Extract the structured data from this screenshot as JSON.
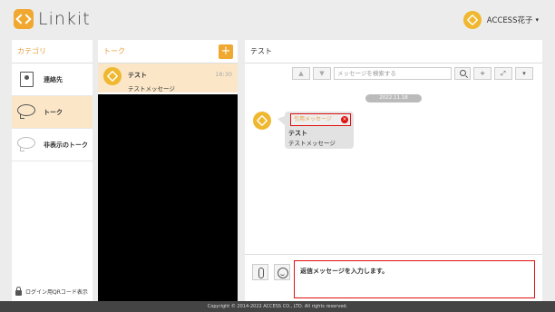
{
  "app": {
    "logo_text": "Linkit"
  },
  "header": {
    "user_name": "ACCESS花子",
    "caret": "▾"
  },
  "categories": {
    "title": "カテゴリ",
    "items": [
      {
        "label": "連絡先",
        "icon": "address-book-icon"
      },
      {
        "label": "トーク",
        "icon": "chat-bubble-icon"
      },
      {
        "label": "非表示のトーク",
        "icon": "hidden-chat-icon"
      }
    ],
    "qr_label": "ログイン用QRコード表示"
  },
  "talk": {
    "title": "トーク",
    "add": "+",
    "items": [
      {
        "name": "テスト",
        "time": "18:30",
        "last_message": "テストメッセージ"
      }
    ]
  },
  "chat": {
    "title": "テスト",
    "toolbar": {
      "up": "▲",
      "down": "▼",
      "search_placeholder": "メッセージを検索する",
      "add": "+",
      "expand": "⤢",
      "menu": "▾"
    },
    "date": "2022.11.18",
    "message": {
      "quote_label": "引用メッセージ",
      "quote_close": "×",
      "sender": "テスト",
      "text": "テストメッセージ"
    },
    "input_value": "返信メッセージを入力します。"
  },
  "footer": {
    "copyright": "Copyright © 2014-2022 ACCESS CO., LTD. All rights reserved."
  },
  "colors": {
    "accent": "#f0a830",
    "highlight_red": "#e01010",
    "selected_bg": "#fbe6c8"
  }
}
